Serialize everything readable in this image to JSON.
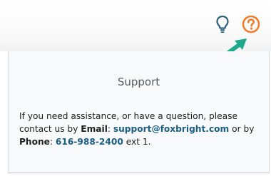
{
  "header": {
    "icons": [
      {
        "name": "lightbulb-icon",
        "color": "#2b5f7b"
      },
      {
        "name": "help-circle-icon",
        "color": "#ef7d2b"
      }
    ],
    "arrow_color": "#1fa88e"
  },
  "support": {
    "title": "Support",
    "text_1": "If you need assistance, or have a question, please contact us by ",
    "email_label": "Email",
    "colon_1": ": ",
    "email": "support@foxbright.com",
    "text_2": " or by ",
    "phone_label": "Phone",
    "colon_2": ": ",
    "phone": "616-988-2400",
    "text_3": " ext 1."
  }
}
